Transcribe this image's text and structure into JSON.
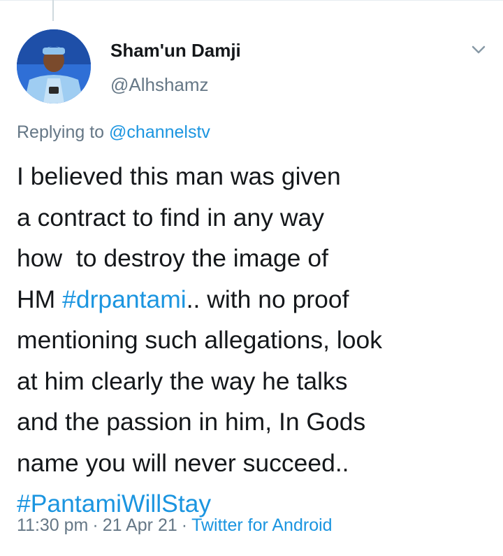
{
  "author": {
    "display_name": "Sham'un Damji",
    "handle": "@Alhshamz",
    "avatar_icon": "user-avatar"
  },
  "reply": {
    "prefix": "Replying to ",
    "mention": "@channelstv"
  },
  "tweet": {
    "line1": "I believed this man was given",
    "line2": "a contract to find in any way",
    "line3": "how  to destroy the image of",
    "line4_pre": "HM ",
    "line4_hashtag": "#drpantami",
    "line4_post": ".. with no proof",
    "line5": "mentioning such allegations, look",
    "line6": "at him clearly the way he talks",
    "line7": "and the passion in him, In Gods",
    "line8": "name you will never succeed..",
    "hashtag2": "#PantamiWillStay"
  },
  "meta": {
    "time": "11:30 pm",
    "date": "21 Apr 21",
    "source": "Twitter for Android",
    "separator": "·"
  },
  "colors": {
    "link": "#1b95e0",
    "secondary_text": "#657786",
    "primary_text": "#14171a"
  }
}
